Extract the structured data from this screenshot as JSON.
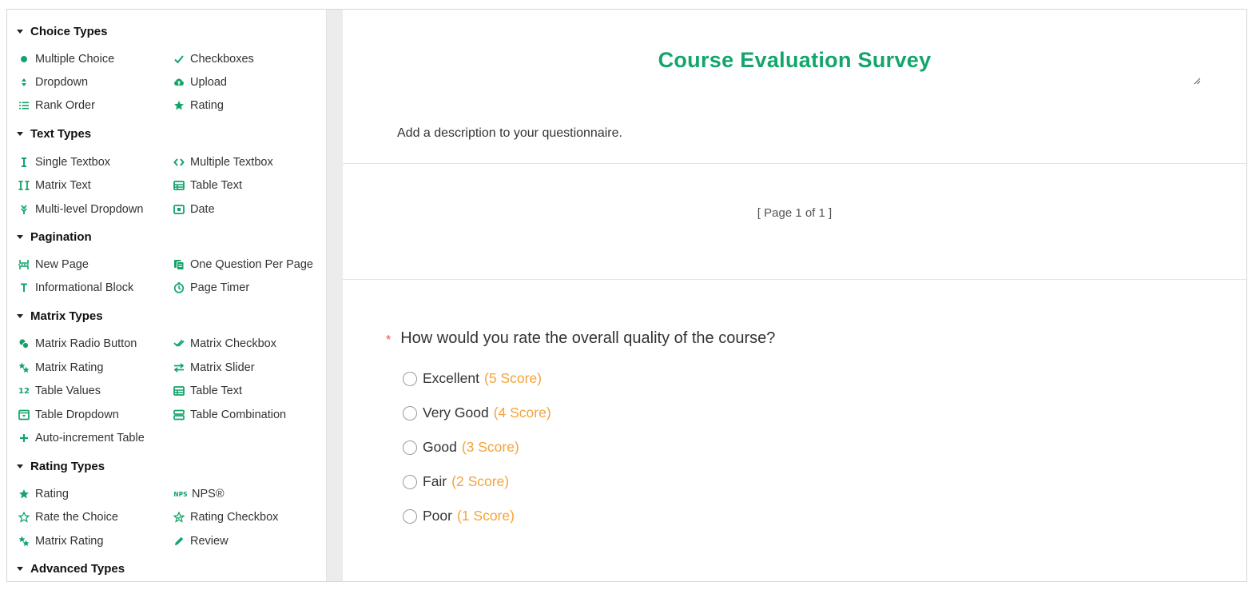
{
  "sidebar": {
    "sections": [
      {
        "label": "Choice Types"
      },
      {
        "label": "Text Types"
      },
      {
        "label": "Pagination"
      },
      {
        "label": "Matrix Types"
      },
      {
        "label": "Rating Types"
      },
      {
        "label": "Advanced Types"
      }
    ],
    "items": {
      "multiple_choice": "Multiple Choice",
      "checkboxes": "Checkboxes",
      "dropdown": "Dropdown",
      "upload": "Upload",
      "rank_order": "Rank Order",
      "rating": "Rating",
      "single_textbox": "Single Textbox",
      "multiple_textbox": "Multiple Textbox",
      "matrix_text": "Matrix Text",
      "table_text": "Table Text",
      "multi_level_dropdown": "Multi-level Dropdown",
      "date": "Date",
      "new_page": "New Page",
      "one_question_per_page": "One Question Per Page",
      "informational_block": "Informational Block",
      "page_timer": "Page Timer",
      "matrix_radio_button": "Matrix Radio Button",
      "matrix_checkbox": "Matrix Checkbox",
      "matrix_rating": "Matrix Rating",
      "matrix_slider": "Matrix Slider",
      "table_values": "Table Values",
      "table_text_2": "Table Text",
      "table_dropdown": "Table Dropdown",
      "table_combination": "Table Combination",
      "auto_increment_table": "Auto-increment Table",
      "rating_2": "Rating",
      "nps": "NPS®",
      "rate_the_choice": "Rate the Choice",
      "rating_checkbox": "Rating Checkbox",
      "matrix_rating_2": "Matrix Rating",
      "review": "Review"
    },
    "icon_text": {
      "table_values": "12",
      "nps": "NPS"
    }
  },
  "survey": {
    "title": "Course Evaluation Survey",
    "description": "Add a description to your questionnaire.",
    "page_indicator": "[ Page 1 of 1 ]",
    "question": {
      "required_mark": "*",
      "text": "How would you rate the overall quality of the course?",
      "options": [
        {
          "label": "Excellent",
          "score": "(5 Score)"
        },
        {
          "label": "Very Good",
          "score": "(4 Score)"
        },
        {
          "label": "Good",
          "score": "(3 Score)"
        },
        {
          "label": "Fair",
          "score": "(2 Score)"
        },
        {
          "label": "Poor",
          "score": "(1 Score)"
        }
      ]
    }
  },
  "colors": {
    "accent": "#14a56d",
    "score": "#f5a33b",
    "required": "#e84c4c"
  }
}
